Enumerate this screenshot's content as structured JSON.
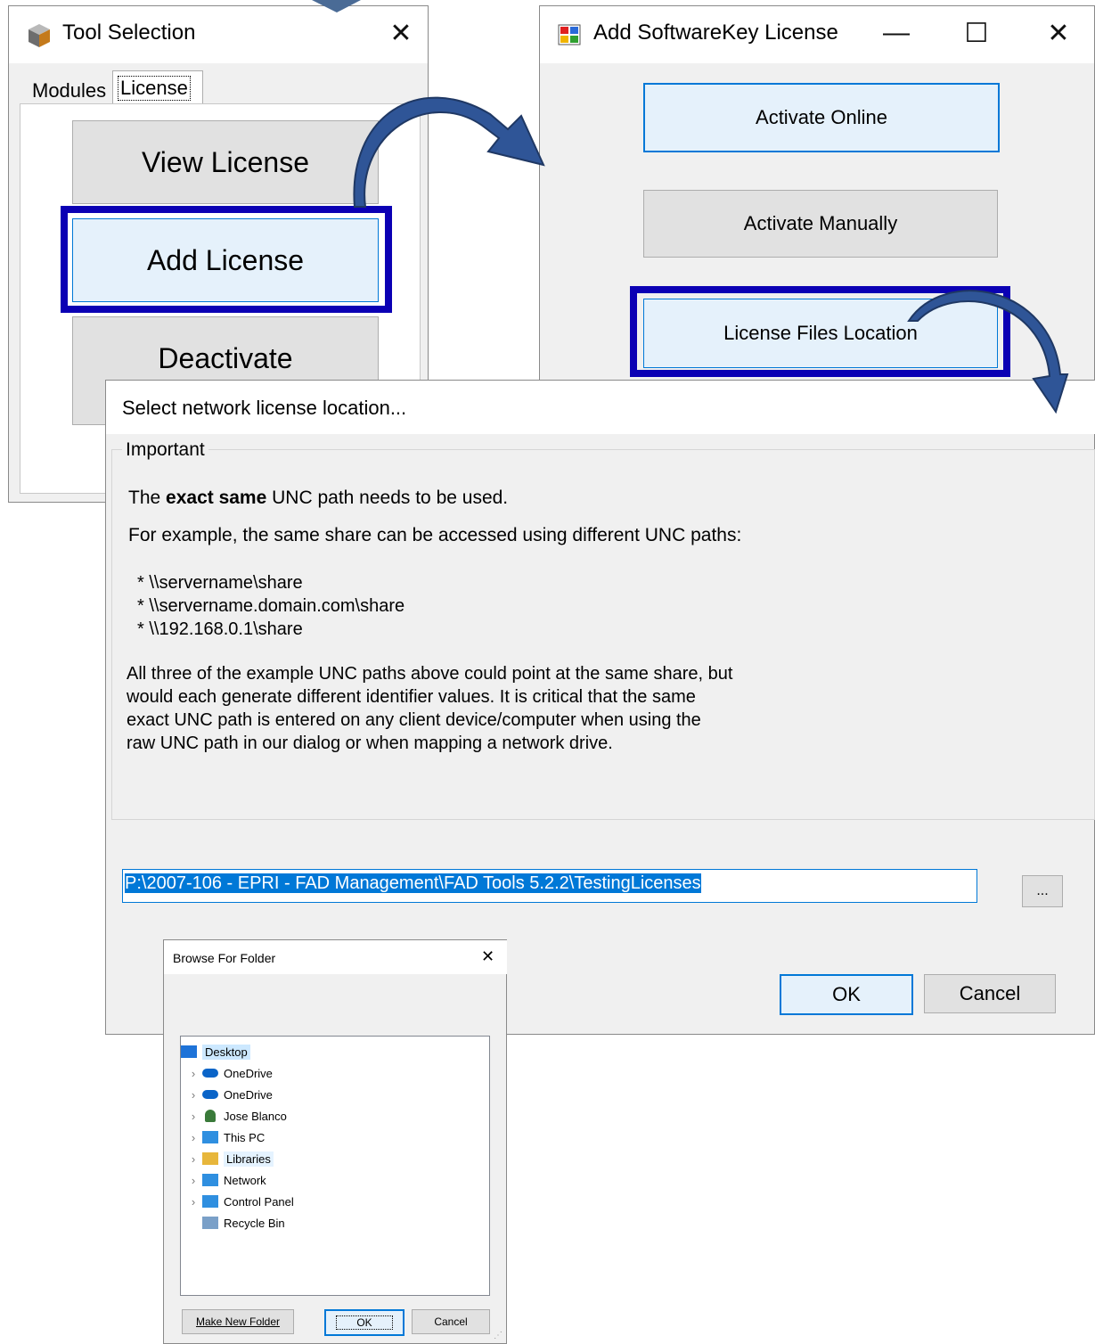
{
  "tool_selection": {
    "title": "Tool Selection",
    "close_glyph": "✕",
    "tabs": [
      "Modules",
      "License"
    ],
    "buttons": [
      "View License",
      "Add License",
      "Deactivate"
    ]
  },
  "add_license": {
    "title": "Add SoftwareKey License",
    "minimize_glyph": "—",
    "maximize_glyph": "☐",
    "close_glyph": "✕",
    "buttons": [
      "Activate Online",
      "Activate Manually",
      "License Files Location"
    ]
  },
  "network_dialog": {
    "title": "Select network license location...",
    "group_label": "Important",
    "line1_pre": "The ",
    "line1_bold": "exact same",
    "line1_post": " UNC path needs to be used.",
    "line2": "For example, the same share can be accessed using different UNC paths:",
    "paths": [
      "* \\\\servername\\share",
      "* \\\\servername.domain.com\\share",
      "* \\\\192.168.0.1\\share"
    ],
    "paragraph": [
      "All three of the example UNC paths above could point at the same share, but",
      "would each generate different identifier values. It is critical that the same",
      "exact UNC path is entered on any client device/computer when using the",
      "raw UNC path in our dialog or when mapping a network drive."
    ],
    "path_value": "P:\\2007-106 - EPRI - FAD Management\\FAD Tools 5.2.2\\TestingLicenses",
    "browse_label": "...",
    "ok_label": "OK",
    "cancel_label": "Cancel"
  },
  "browse_folder": {
    "title": "Browse For Folder",
    "close_glyph": "✕",
    "items": [
      {
        "label": "Desktop",
        "icon": "desktop-icon",
        "chevron": ""
      },
      {
        "label": "OneDrive",
        "icon": "cloud-icon",
        "chevron": "›"
      },
      {
        "label": "OneDrive",
        "icon": "cloud-icon",
        "chevron": "›"
      },
      {
        "label": "Jose Blanco",
        "icon": "user-icon",
        "chevron": "›"
      },
      {
        "label": "This PC",
        "icon": "computer-icon",
        "chevron": "›"
      },
      {
        "label": "Libraries",
        "icon": "library-icon",
        "chevron": "›"
      },
      {
        "label": "Network",
        "icon": "network-icon",
        "chevron": "›"
      },
      {
        "label": "Control Panel",
        "icon": "control-panel-icon",
        "chevron": "›"
      },
      {
        "label": "Recycle Bin",
        "icon": "recycle-bin-icon",
        "chevron": ""
      }
    ],
    "make_folder_label": "Make New Folder",
    "ok_label": "OK",
    "cancel_label": "Cancel"
  },
  "colors": {
    "highlight_border": "#0b00b4",
    "arrow_fill": "#2f5597",
    "selection_blue": "#0078d7"
  }
}
